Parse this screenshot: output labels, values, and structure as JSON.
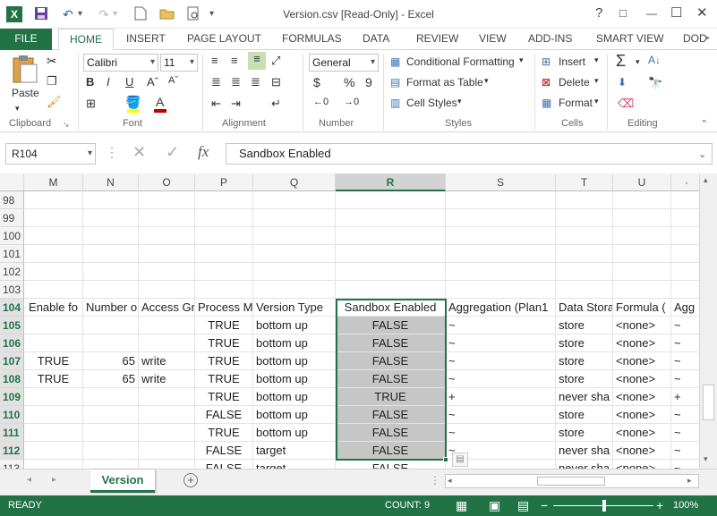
{
  "window": {
    "title": "Version.csv  [Read-Only] - Excel",
    "help": "?",
    "restore": "□",
    "minimize": "—",
    "maximize": "☐",
    "close": "✕"
  },
  "tabs": [
    "FILE",
    "HOME",
    "INSERT",
    "PAGE LAYOUT",
    "FORMULAS",
    "DATA",
    "REVIEW",
    "VIEW",
    "ADD-INS",
    "SMART VIEW",
    "DOD"
  ],
  "ribbon": {
    "paste": "Paste",
    "font_name": "Calibri",
    "font_size": "11",
    "number_format": "General",
    "currency": "$",
    "percent": "%",
    "comma": "9",
    "conditional_formatting": "Conditional Formatting",
    "format_as_table": "Format as Table",
    "cell_styles": "Cell Styles",
    "insert": "Insert",
    "delete": "Delete",
    "format": "Format",
    "groups": {
      "clipboard": "Clipboard",
      "font": "Font",
      "alignment": "Alignment",
      "number": "Number",
      "styles": "Styles",
      "cells": "Cells",
      "editing": "Editing"
    }
  },
  "formula_bar": {
    "name_box": "R104",
    "fx": "fx",
    "content": "Sandbox Enabled"
  },
  "columns": [
    "M",
    "N",
    "O",
    "P",
    "Q",
    "R",
    "S",
    "T",
    "U",
    "·"
  ],
  "rows": [
    {
      "num": "98",
      "cells": [
        "",
        "",
        "",
        "",
        "",
        "",
        "",
        "",
        "",
        ""
      ]
    },
    {
      "num": "99",
      "cells": [
        "",
        "",
        "",
        "",
        "",
        "",
        "",
        "",
        "",
        ""
      ]
    },
    {
      "num": "100",
      "cells": [
        "",
        "",
        "",
        "",
        "",
        "",
        "",
        "",
        "",
        ""
      ]
    },
    {
      "num": "101",
      "cells": [
        "",
        "",
        "",
        "",
        "",
        "",
        "",
        "",
        "",
        ""
      ]
    },
    {
      "num": "102",
      "cells": [
        "",
        "",
        "",
        "",
        "",
        "",
        "",
        "",
        "",
        ""
      ]
    },
    {
      "num": "103",
      "cells": [
        "",
        "",
        "",
        "",
        "",
        "",
        "",
        "",
        "",
        ""
      ]
    },
    {
      "num": "104",
      "cells": [
        "Enable fo",
        "Number o",
        "Access Gr",
        "Process M",
        "Version Type",
        "Sandbox Enabled",
        "Aggregation (Plan1",
        "Data Stora",
        "Formula (",
        "Agg"
      ]
    },
    {
      "num": "105",
      "cells": [
        "",
        "",
        "",
        "TRUE",
        "bottom up",
        "FALSE",
        "~",
        "store",
        "<none>",
        "~"
      ]
    },
    {
      "num": "106",
      "cells": [
        "",
        "",
        "",
        "TRUE",
        "bottom up",
        "FALSE",
        "~",
        "store",
        "<none>",
        "~"
      ]
    },
    {
      "num": "107",
      "cells": [
        "TRUE",
        "65",
        "write",
        "TRUE",
        "bottom up",
        "FALSE",
        "~",
        "store",
        "<none>",
        "~"
      ]
    },
    {
      "num": "108",
      "cells": [
        "TRUE",
        "65",
        "write",
        "TRUE",
        "bottom up",
        "FALSE",
        "~",
        "store",
        "<none>",
        "~"
      ]
    },
    {
      "num": "109",
      "cells": [
        "",
        "",
        "",
        "TRUE",
        "bottom up",
        "TRUE",
        "+",
        "never sha",
        "<none>",
        "+"
      ]
    },
    {
      "num": "110",
      "cells": [
        "",
        "",
        "",
        "FALSE",
        "bottom up",
        "FALSE",
        "~",
        "store",
        "<none>",
        "~"
      ]
    },
    {
      "num": "111",
      "cells": [
        "",
        "",
        "",
        "TRUE",
        "bottom up",
        "FALSE",
        "~",
        "store",
        "<none>",
        "~"
      ]
    },
    {
      "num": "112",
      "cells": [
        "",
        "",
        "",
        "FALSE",
        "target",
        "FALSE",
        "~",
        "never sha",
        "<none>",
        "~"
      ]
    },
    {
      "num": "113",
      "cells": [
        "",
        "",
        "",
        "FALSE",
        "target",
        "FALSE",
        "",
        "never sha",
        "<none>",
        "~"
      ]
    }
  ],
  "sheet_tab": "Version",
  "status": {
    "ready": "READY",
    "count": "COUNT: 9",
    "zoom": "100%"
  },
  "colors": {
    "excel_green": "#217346",
    "selection_gray": "#c6c6c6"
  }
}
